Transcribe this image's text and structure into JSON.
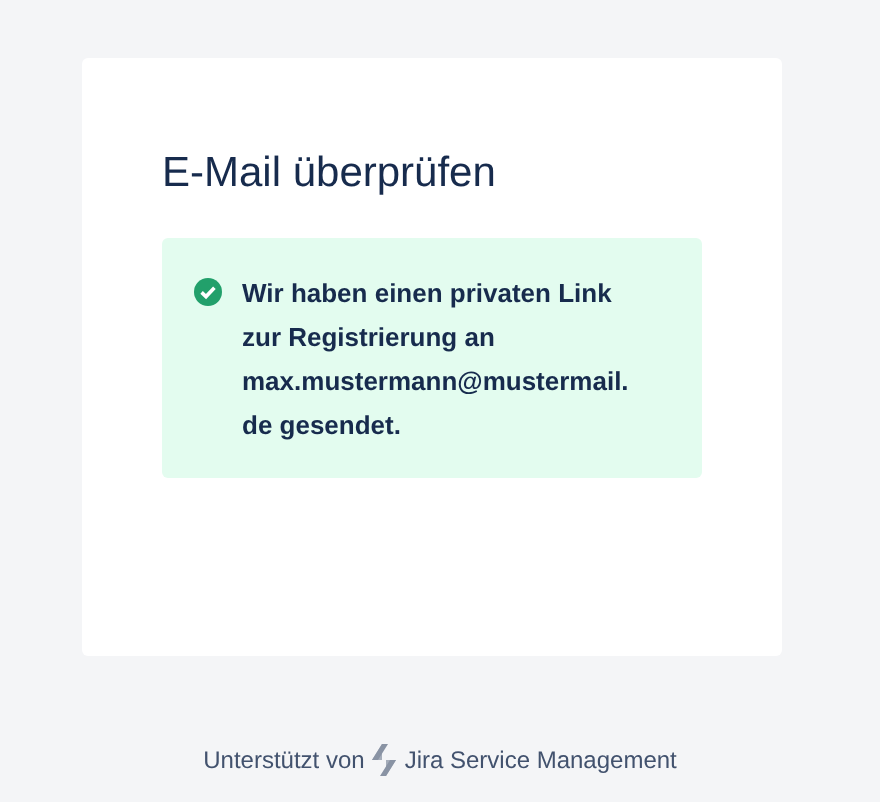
{
  "card": {
    "title": "E-Mail überprüfen",
    "message": {
      "kind": "success",
      "lines": [
        "Wir haben einen privaten Link",
        "zur Registrierung an",
        "max.mustermann@mustermail.",
        "de gesendet."
      ]
    }
  },
  "footer": {
    "prefix": "Unterstützt von",
    "product": "Jira Service Management"
  }
}
